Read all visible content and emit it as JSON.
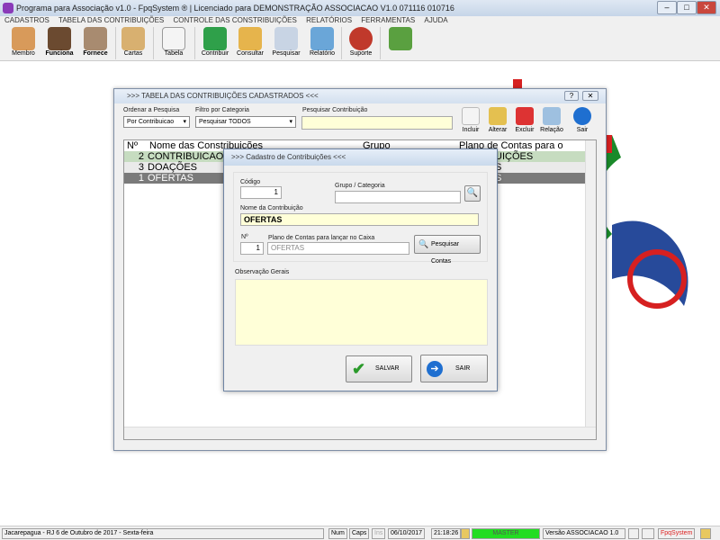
{
  "window_title": "Programa para Associação v1.0 - FpqSystem ® | Licenciado para  DEMONSTRAÇÃO ASSOCIACAO V1.0 071116 010716",
  "menu": [
    "CADASTROS",
    "TABELA DAS CONTRIBUIÇÕES",
    "CONTROLE DAS CONSTRIBUIÇÕES",
    "RELATÓRIOS",
    "FERRAMENTAS",
    "AJUDA"
  ],
  "toolbar": [
    {
      "label": "Membro",
      "icon": "members-icon"
    },
    {
      "label": "Funciona",
      "icon": "employees-icon"
    },
    {
      "label": "Fornece",
      "icon": "supplier-icon"
    },
    {
      "label": "Cartas",
      "icon": "letters-icon"
    },
    {
      "label": "Tabela",
      "icon": "table-icon"
    },
    {
      "label": "Contribuir",
      "icon": "dollar-icon"
    },
    {
      "label": "Consultar",
      "icon": "folder-icon"
    },
    {
      "label": "Pesquisar",
      "icon": "search-doc-icon"
    },
    {
      "label": "Relatório",
      "icon": "printer-icon"
    },
    {
      "label": "Suporte",
      "icon": "support-icon"
    },
    {
      "label": "",
      "icon": "exit-icon"
    }
  ],
  "table_window": {
    "title": ">>>  TABELA DAS CONTRIBUIÇÕES CADASTRADOS  <<<",
    "help": "?",
    "close": "✕",
    "order_label": "Ordenar a Pesquisa",
    "order_value": "Por Contribuicao",
    "filter_label": "Filtro por Categoria",
    "filter_value": "Pesquisar TODOS",
    "search_label": "Pesquisar Contribuição",
    "search_value": "",
    "actions": [
      "Incluir",
      "Alterar",
      "Excluir",
      "Relação",
      "Sair"
    ],
    "columns": [
      "Nº",
      "Nome das Constribuições",
      "Grupo",
      "Plano de Contas para o Caixa"
    ],
    "rows": [
      {
        "n": "2",
        "nome": "CONTRIBUICAO",
        "grupo": "",
        "plano": "UIÇÕES"
      },
      {
        "n": "3",
        "nome": "DOAÇÕES",
        "grupo": "",
        "plano": "S"
      },
      {
        "n": "1",
        "nome": "OFERTAS",
        "grupo": "",
        "plano": "S"
      }
    ]
  },
  "modal": {
    "title": ">>>  Cadastro de Contribuições  <<<",
    "codigo_label": "Código",
    "codigo": "1",
    "grupo_label": "Grupo / Categoria",
    "grupo": "",
    "nome_label": "Nome da Contribuição",
    "nome": "OFERTAS",
    "n_label": "Nº",
    "n": "1",
    "plano_label": "Plano de Contas para lançar no Caixa",
    "plano": "OFERTAS",
    "pesquisar_contas": "Pesquisar Contas",
    "obs_label": "Observação Gerais",
    "obs": "",
    "salvar": "SALVAR",
    "sair": "SAIR"
  },
  "status": {
    "location": "Jacarepagua - RJ  6 de Outubro de 2017 - Sexta-feira",
    "num": "Num",
    "caps": "Caps",
    "ins": "Ins",
    "date": "06/10/2017",
    "time": "21:18:26",
    "user": "MASTER",
    "version": "Versão ASSOCIACAO 1.0",
    "brand": "FpqSystem"
  }
}
